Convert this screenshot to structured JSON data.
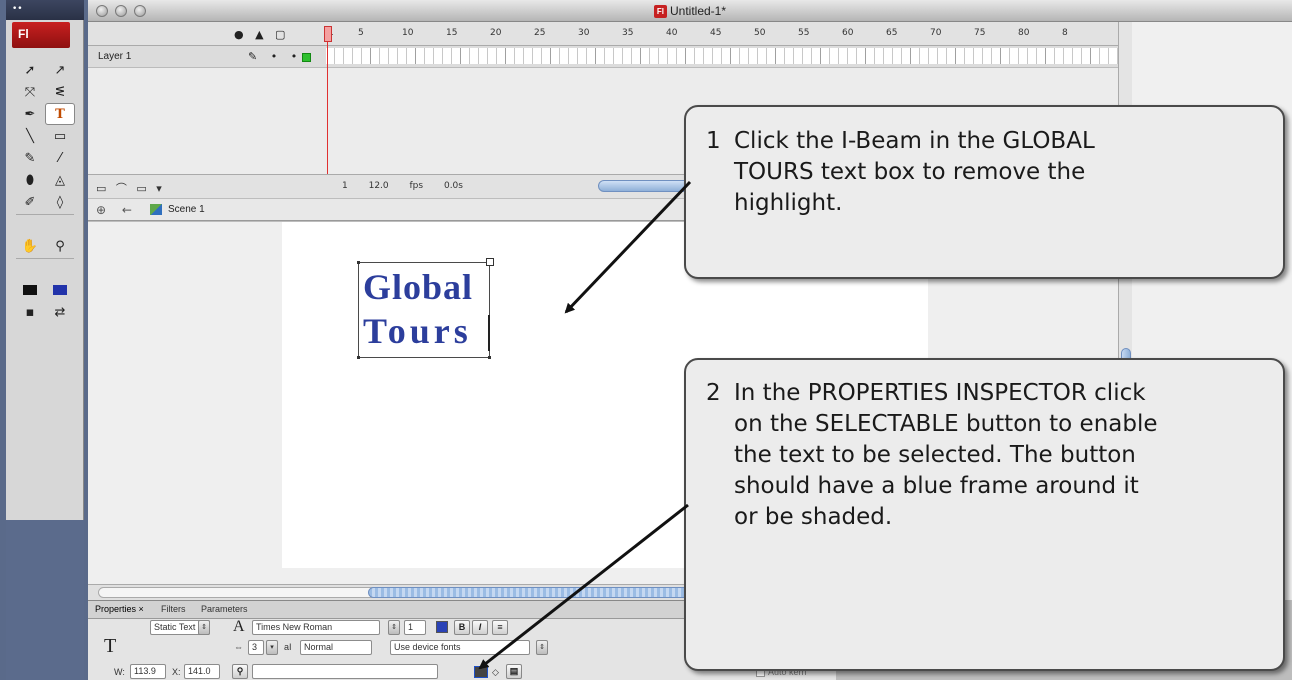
{
  "app": {
    "window_title": "Untitled-1*",
    "logo": "Fl"
  },
  "tools_panel": {
    "strip_label": "••",
    "tools": [
      {
        "name": "selection-tool-icon",
        "glyph": "➚"
      },
      {
        "name": "subselection-tool-icon",
        "glyph": "↗"
      },
      {
        "name": "free-transform-tool-icon",
        "glyph": "⤧"
      },
      {
        "name": "lasso-tool-icon",
        "glyph": "ᓬ"
      },
      {
        "name": "pen-tool-icon",
        "glyph": "✒"
      },
      {
        "name": "text-tool-icon",
        "glyph": "T"
      },
      {
        "name": "line-tool-icon",
        "glyph": "╲"
      },
      {
        "name": "rectangle-tool-icon",
        "glyph": "▭"
      },
      {
        "name": "pencil-tool-icon",
        "glyph": "✎"
      },
      {
        "name": "brush-tool-icon",
        "glyph": "⁄"
      },
      {
        "name": "ink-bottle-tool-icon",
        "glyph": "⬮"
      },
      {
        "name": "paint-bucket-tool-icon",
        "glyph": "◬"
      },
      {
        "name": "eyedropper-tool-icon",
        "glyph": "✐"
      },
      {
        "name": "eraser-tool-icon",
        "glyph": "◊"
      },
      {
        "name": "hand-tool-icon",
        "glyph": "✋"
      },
      {
        "name": "zoom-tool-icon",
        "glyph": "⚲"
      }
    ]
  },
  "timeline": {
    "header_icons": "● ▲ ▢",
    "frame_ticks": [
      "1",
      "5",
      "10",
      "15",
      "20",
      "25",
      "30",
      "35",
      "40",
      "45",
      "50",
      "55",
      "60",
      "65",
      "70",
      "75",
      "80",
      "8"
    ],
    "layer_name": "Layer 1",
    "layer_state": "✎ • •",
    "footer_icons": "▭ ⌒ ▭ ▾",
    "current_frame": "1",
    "frame_rate": "12.0 fps",
    "elapsed_time": "0.0s"
  },
  "editbar": {
    "nav_icons": "⊕ ←",
    "scene": "Scene 1"
  },
  "stage": {
    "text_line1": "Global",
    "text_line2": "Tours",
    "text_color": "#2c3e9c"
  },
  "properties": {
    "tabs": [
      "Properties ×",
      "Filters",
      "Parameters"
    ],
    "text_type": "Static Text",
    "font_family": "Times New Roman",
    "letter_spacing": "3",
    "char_position": "Normal",
    "rendering": "Use device fonts",
    "width_label": "W:",
    "width": "113.9",
    "x_label": "X:",
    "x": "141.0",
    "autokern_label": "Auto kern",
    "font_size": "1"
  },
  "callouts": {
    "step1": {
      "number": "1",
      "line1": "Click the I-Beam in the GLOBAL",
      "line2": "TOURS text box to remove the",
      "line3": "highlight."
    },
    "step2": {
      "number": "2",
      "line1": "In the PROPERTIES INSPECTOR click",
      "line2": "on the SELECTABLE button to enable",
      "line3": "the text to be selected.  The button",
      "line4": "should have a blue frame around it",
      "line5": "or be shaded."
    }
  },
  "colors": {
    "accent_blue": "#2a42b6",
    "playhead_red": "#e03030",
    "flash_red": "#c82020"
  }
}
